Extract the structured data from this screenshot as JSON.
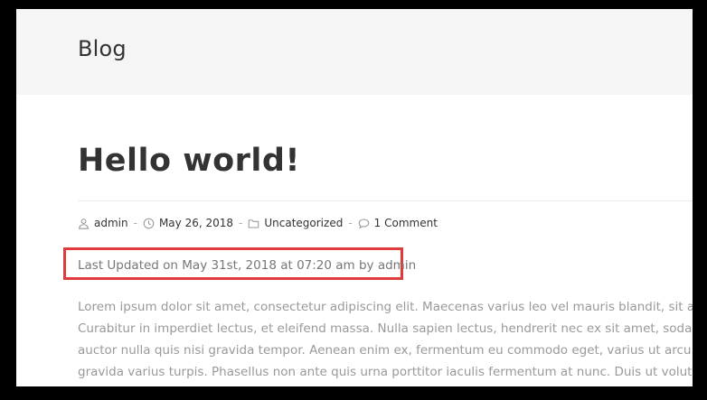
{
  "header": {
    "title": "Blog"
  },
  "post": {
    "title": "Hello world!",
    "meta": {
      "author": "admin",
      "date": "May 26, 2018",
      "category": "Uncategorized",
      "comments": "1 Comment",
      "separator": "-"
    },
    "last_updated": "Last Updated on May 31st, 2018 at 07:20 am by admin",
    "highlight_color": "#e03b3b",
    "body_lines": [
      "Lorem ipsum dolor sit amet, consectetur adipiscing elit. Maecenas varius leo vel mauris blandit, sit amet",
      "Curabitur in imperdiet lectus, et eleifend massa. Nulla sapien lectus, hendrerit nec ex sit amet, sodales ve",
      "auctor nulla quis nisi gravida tempor. Aenean enim ex, fermentum eu commodo eget, varius ut arcu. Inte",
      "gravida varius turpis. Phasellus non ante quis urna porttitor iaculis fermentum at nunc. Duis ut volutpat p"
    ]
  }
}
